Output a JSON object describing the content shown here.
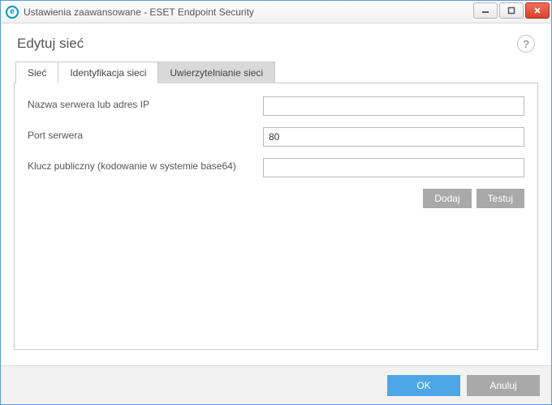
{
  "window": {
    "title": "Ustawienia zaawansowane - ESET Endpoint Security",
    "icon_letter": "e"
  },
  "header": {
    "title": "Edytuj sieć",
    "help": "?"
  },
  "tabs": [
    {
      "label": "Sieć",
      "active": false
    },
    {
      "label": "Identyfikacja sieci",
      "active": false
    },
    {
      "label": "Uwierzytelnianie sieci",
      "active": true
    }
  ],
  "form": {
    "server_address": {
      "label": "Nazwa serwera lub adres IP",
      "value": ""
    },
    "server_port": {
      "label": "Port serwera",
      "value": "80"
    },
    "public_key": {
      "label": "Klucz publiczny (kodowanie w systemie base64)",
      "value": ""
    }
  },
  "buttons": {
    "add": "Dodaj",
    "test": "Testuj",
    "ok": "OK",
    "cancel": "Anuluj"
  }
}
